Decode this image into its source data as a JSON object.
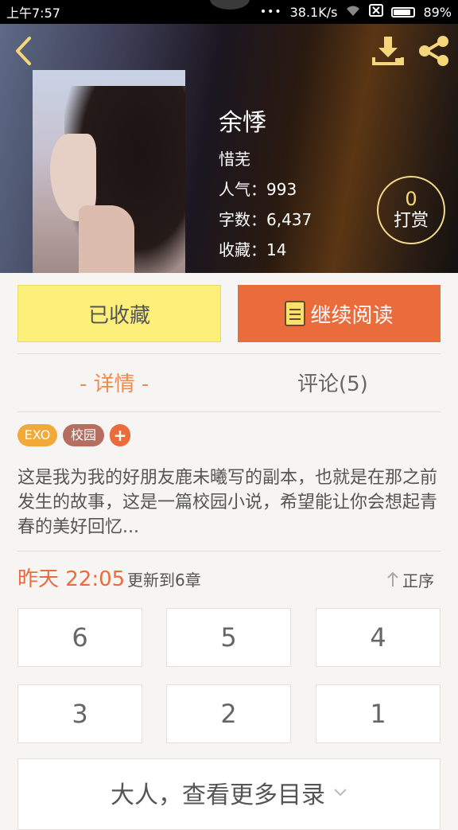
{
  "status_bar": {
    "time": "上午7:57",
    "dots": "•••",
    "speed": "38.1K/s",
    "battery": "89%",
    "battery_level": 0.89
  },
  "book": {
    "title": "余悸",
    "author": "惜芜",
    "popularity": "人气：993",
    "word_count": "字数：6,437",
    "favorites": "收藏：14"
  },
  "reward": {
    "count": "0",
    "label": "打赏"
  },
  "actions": {
    "collected_label": "已收藏",
    "read_label": "继续阅读"
  },
  "tabs": {
    "details": "- 详情 -",
    "comments": "评论(5)"
  },
  "tags": [
    "EXO",
    "校园",
    "+"
  ],
  "description": "这是我为我的好朋友鹿未曦写的副本，也就是在那之前发生的故事，这是一篇校园小说，希望能让你会想起青春的美好回忆...",
  "update": {
    "time": "昨天 22:05",
    "text": "更新到6章",
    "sort_label": "正序"
  },
  "chapters": [
    "6",
    "5",
    "4",
    "3",
    "2",
    "1"
  ],
  "more_label": "大人，查看更多目录",
  "colors": {
    "accent": "#ea6b3c",
    "highlight": "#fdf07a",
    "icon_yellow": "#f6d67a"
  },
  "icons": [
    "back-icon",
    "download-icon",
    "share-icon",
    "book-icon",
    "sort-up-icon",
    "chevron-down-icon"
  ]
}
